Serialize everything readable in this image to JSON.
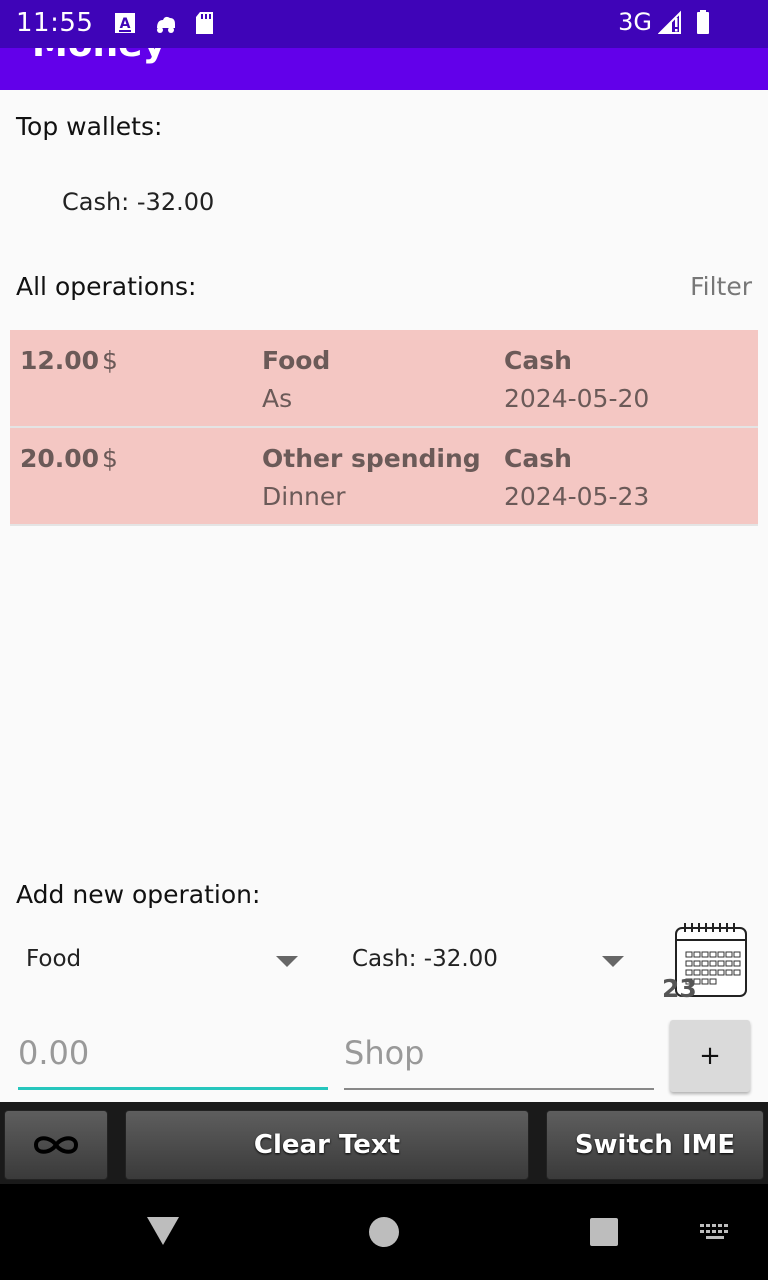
{
  "status_bar": {
    "time": "11:55",
    "network": "3G",
    "icons": [
      "text-a-icon",
      "cloud-car-icon",
      "sd-card-icon",
      "signal-icon",
      "battery-icon"
    ]
  },
  "app_bar": {
    "title": "Money",
    "color": "#6200ea"
  },
  "top_wallets": {
    "label": "Top wallets:",
    "items": [
      "Cash: -32.00"
    ]
  },
  "operations": {
    "label": "All operations:",
    "filter_label": "Filter",
    "row_color": "#f4c7c3",
    "rows": [
      {
        "amount": "12.00",
        "currency": "$",
        "category": "Food",
        "note": "As",
        "wallet": "Cash",
        "date": "2024-05-20"
      },
      {
        "amount": "20.00",
        "currency": "$",
        "category": "Other spending",
        "note": "Dinner",
        "wallet": "Cash",
        "date": "2024-05-23"
      }
    ]
  },
  "add_operation": {
    "label": "Add new operation:",
    "category_value": "Food",
    "wallet_value": "Cash: -32.00",
    "date_day": "23",
    "amount_placeholder": "0.00",
    "note_placeholder": "Shop",
    "add_label": "+"
  },
  "keyboard_bar": {
    "clear_label": "Clear Text",
    "switch_label": "Switch IME"
  }
}
